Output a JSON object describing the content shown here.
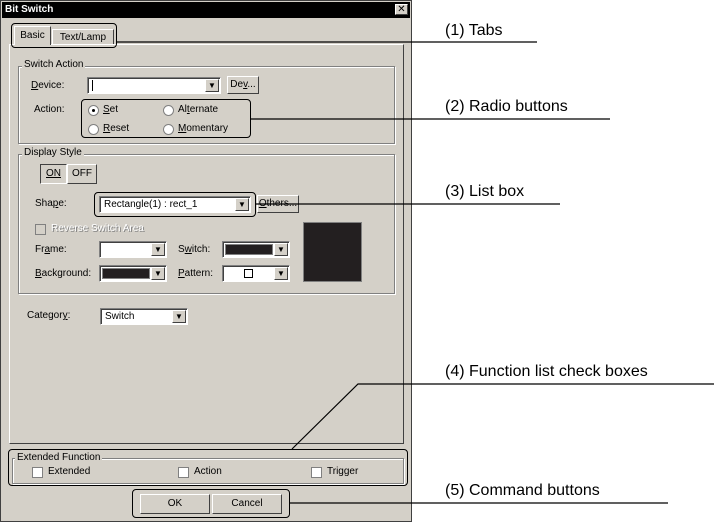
{
  "dialog": {
    "title": "Bit Switch",
    "close_glyph": "✕",
    "tabs": [
      "Basic",
      "Text/Lamp"
    ],
    "switch_action": {
      "legend": "Switch Action",
      "device_label_u": "D",
      "device_label_rest": "evice:",
      "device_value": "",
      "dev_button_pre": "De",
      "dev_button_u": "v",
      "dev_button_post": "...",
      "action_label": "Action:",
      "radios": [
        {
          "u": "S",
          "rest": "et",
          "checked": true
        },
        {
          "pre": "Al",
          "u": "t",
          "rest": "ernate",
          "checked": false
        },
        {
          "u": "R",
          "rest": "eset",
          "checked": false
        },
        {
          "u": "M",
          "rest": "omentary",
          "checked": false
        }
      ]
    },
    "display_style": {
      "legend": "Display Style",
      "on_label": "ON",
      "off_label": "OFF",
      "shape_label_pre": "Sha",
      "shape_label_u": "p",
      "shape_label_post": "e:",
      "shape_value": "Rectangle(1) : rect_1",
      "others_button_u": "O",
      "others_button_rest": "thers...",
      "reverse_label": "Reverse Switch Area",
      "frame_label_pre": "Fr",
      "frame_label_u": "a",
      "frame_label_post": "me:",
      "switch_label_pre": "S",
      "switch_label_u": "w",
      "switch_label_post": "itch:",
      "background_label_u": "B",
      "background_label_rest": "ackground:",
      "pattern_label_u": "P",
      "pattern_label_rest": "attern:",
      "frame_color": "#ffffff",
      "switch_color": "#231f20",
      "background_color": "#231f20",
      "preview_color": "#231f20"
    },
    "category": {
      "label_pre": "Categor",
      "label_u": "y",
      "label_post": ":",
      "value": "Switch"
    },
    "extended_function": {
      "legend": "Extended Function",
      "checks": [
        "Extended",
        "Action",
        "Trigger"
      ]
    },
    "buttons": {
      "ok": "OK",
      "cancel": "Cancel"
    }
  },
  "annotations": [
    "(1) Tabs",
    "(2) Radio buttons",
    "(3) List box",
    "(4) Function list check boxes",
    "(5) Command buttons"
  ],
  "icons": {
    "dropdown": "dropdown-arrow-icon",
    "close": "close-icon"
  }
}
